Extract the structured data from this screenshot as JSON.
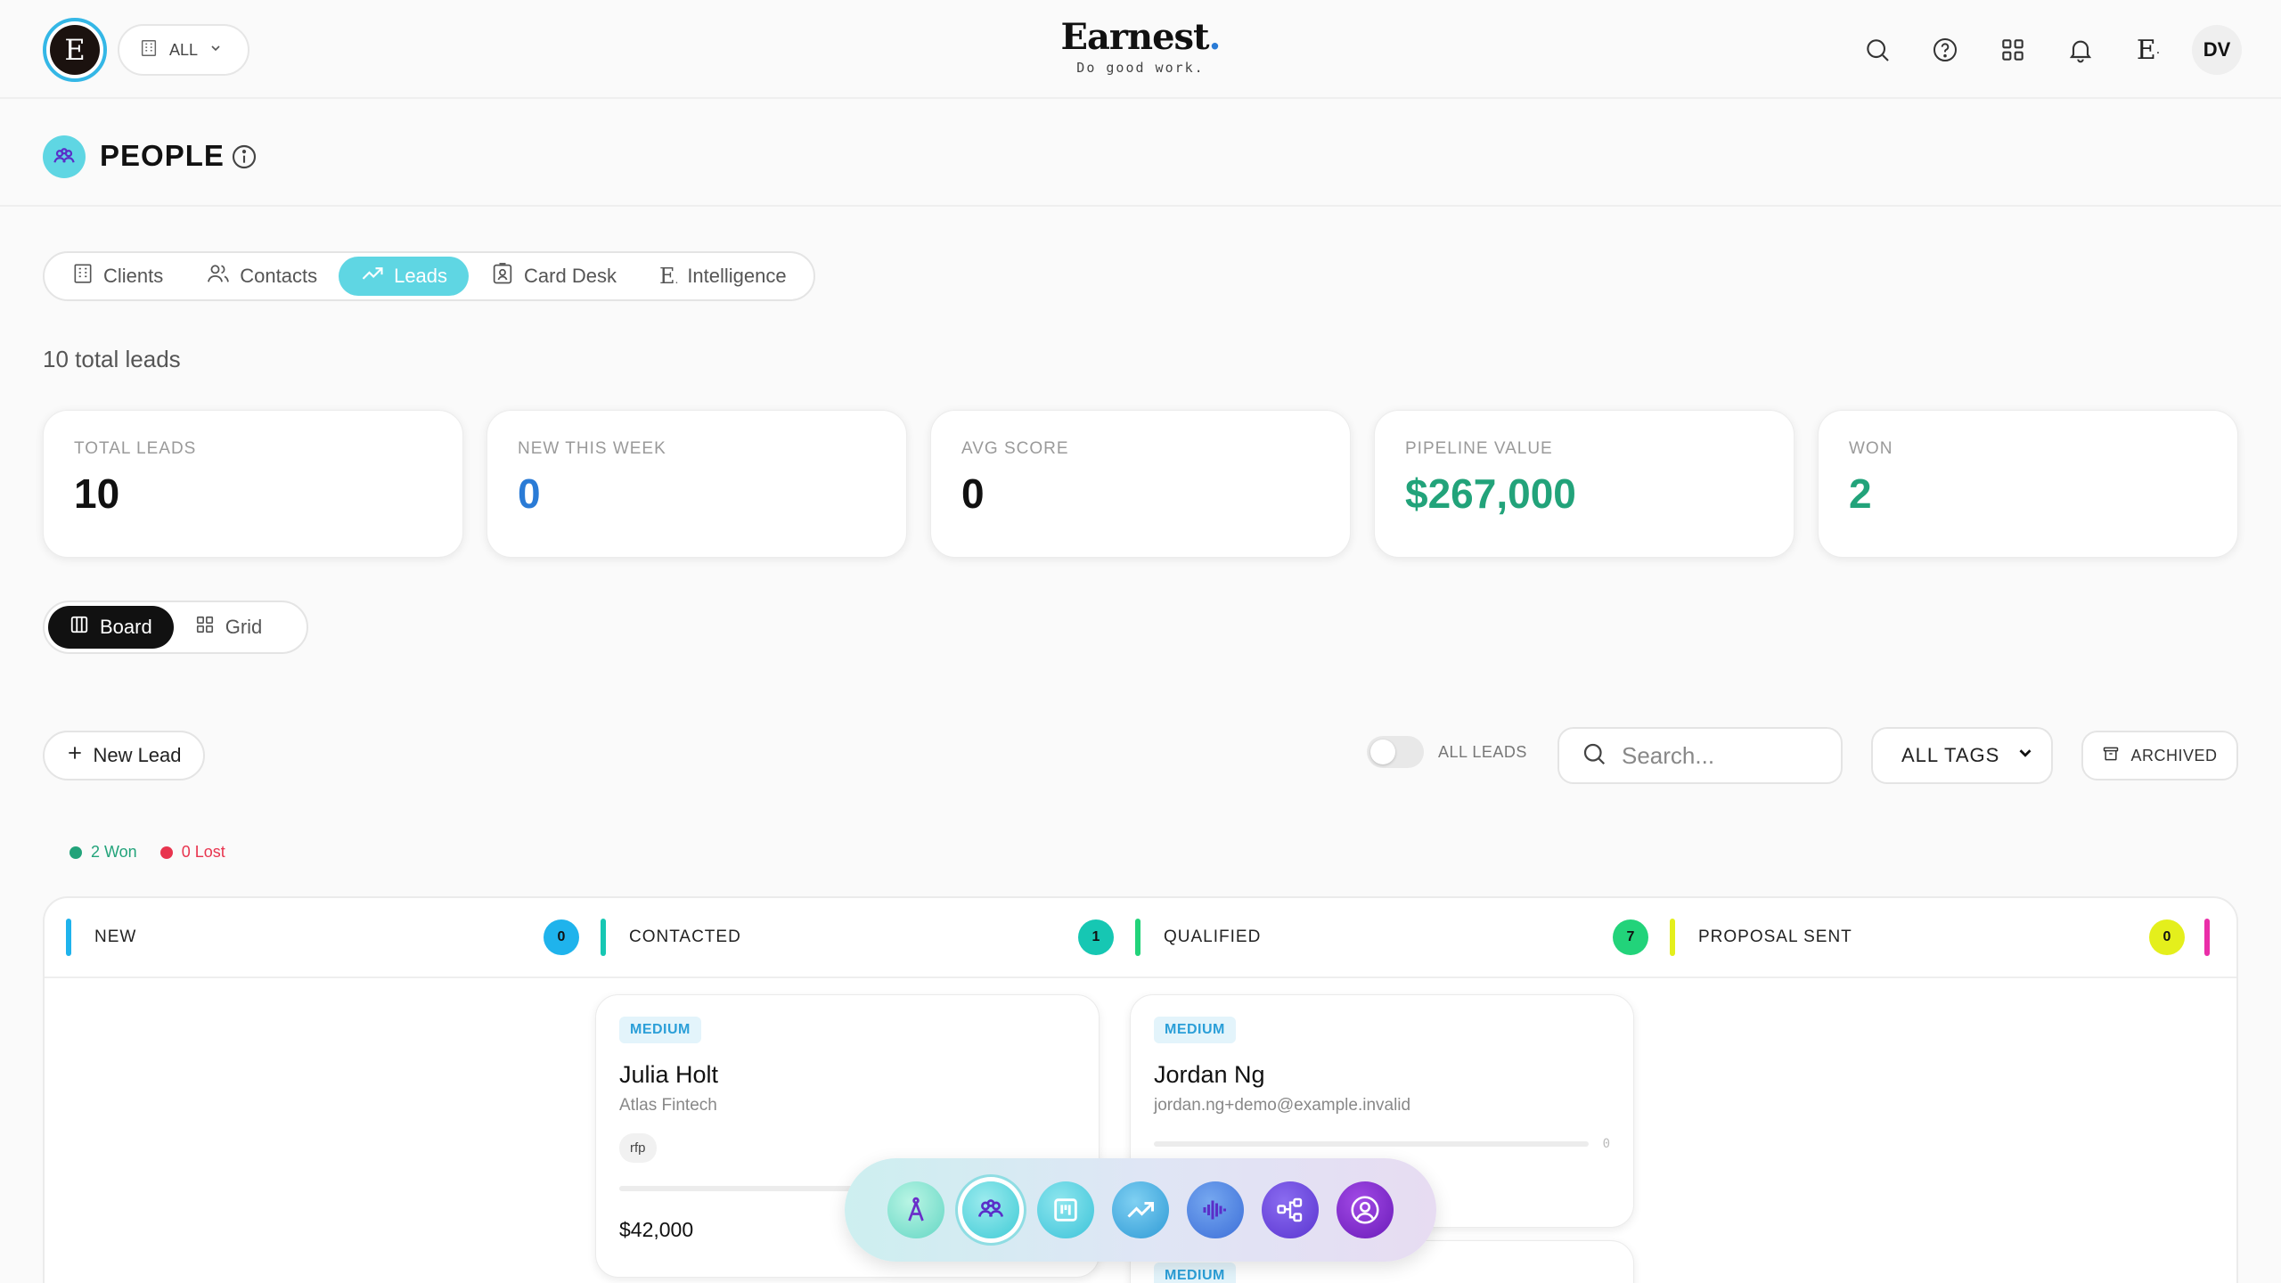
{
  "app": {
    "brand_name": "Earnest",
    "brand_dot": ".",
    "tagline": "Do good work.",
    "logo_letter": "E",
    "scope_label": "ALL",
    "user_initials": "DV"
  },
  "page": {
    "title": "PEOPLE"
  },
  "tabs": [
    {
      "label": "Clients",
      "icon": "building-icon"
    },
    {
      "label": "Contacts",
      "icon": "users-icon"
    },
    {
      "label": "Leads",
      "icon": "trending-up-icon",
      "active": true
    },
    {
      "label": "Card Desk",
      "icon": "id-card-icon"
    },
    {
      "label": "Intelligence",
      "icon": "earnest-e-icon"
    }
  ],
  "summary": {
    "total_text": "10 total leads"
  },
  "stats": [
    {
      "label": "TOTAL LEADS",
      "value": "10"
    },
    {
      "label": "NEW THIS WEEK",
      "value": "0"
    },
    {
      "label": "AVG SCORE",
      "value": "0"
    },
    {
      "label": "PIPELINE VALUE",
      "value": "$267,000"
    },
    {
      "label": "WON",
      "value": "2"
    }
  ],
  "view_toggle": {
    "board": "Board",
    "grid": "Grid",
    "active": "Board"
  },
  "toolbar": {
    "new_lead": "New Lead",
    "all_leads": "ALL LEADS",
    "search_placeholder": "Search...",
    "tags_selected": "ALL TAGS",
    "archived": "ARCHIVED"
  },
  "legend": {
    "won": "2 Won",
    "lost": "0 Lost"
  },
  "columns": [
    {
      "title": "NEW",
      "count": "0",
      "color": "#1fb3ec"
    },
    {
      "title": "CONTACTED",
      "count": "1",
      "color": "#16c7b3"
    },
    {
      "title": "QUALIFIED",
      "count": "7",
      "color": "#22d37a"
    },
    {
      "title": "PROPOSAL SENT",
      "count": "0",
      "color": "#e4ef1c"
    },
    {
      "title": "",
      "count": "",
      "color": "#ea2ea8"
    }
  ],
  "cards": {
    "julia": {
      "priority": "MEDIUM",
      "name": "Julia Holt",
      "company": "Atlas Fintech",
      "tag": "rfp",
      "amount": "$42,000"
    },
    "jordan": {
      "priority": "MEDIUM",
      "name": "Jordan Ng",
      "email": "jordan.ng+demo@example.invalid",
      "score": "0"
    },
    "third": {
      "priority": "MEDIUM"
    }
  },
  "dock": [
    "compass-icon",
    "people-icon",
    "kanban-icon",
    "trending-up-icon",
    "audio-waveform-icon",
    "network-icon",
    "user-circle-icon"
  ],
  "colors": {
    "accent": "#5fd6e3",
    "won": "#22a37a",
    "lost": "#e8344e",
    "blue": "#2a7bd6"
  }
}
